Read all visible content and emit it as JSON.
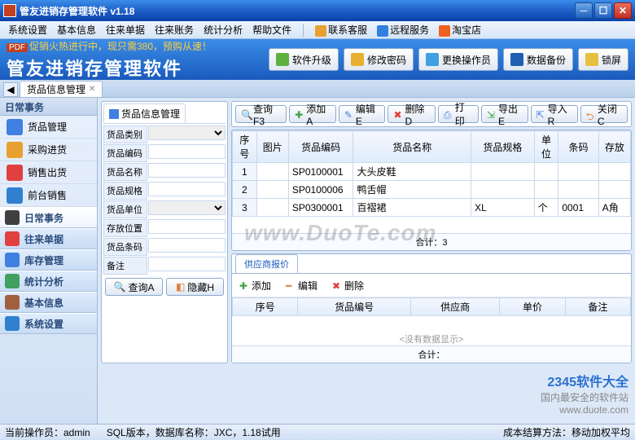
{
  "window": {
    "title": "管友进销存管理软件  v1.18"
  },
  "menu": {
    "items": [
      "系统设置",
      "基本信息",
      "往来单据",
      "往来账务",
      "统计分析",
      "帮助文件"
    ],
    "right": [
      {
        "label": "联系客服",
        "icon": "#e8a030"
      },
      {
        "label": "远程服务",
        "icon": "#3080e0"
      },
      {
        "label": "淘宝店",
        "icon": "#f06020"
      }
    ]
  },
  "banner": {
    "promo_badge": "PDF",
    "promo": "促销火热进行中，现只需380，预购从速！",
    "title": "管友进销存管理软件",
    "buttons": [
      {
        "label": "软件升级",
        "color": "#60b040"
      },
      {
        "label": "修改密码",
        "color": "#e8b030"
      },
      {
        "label": "更换操作员",
        "color": "#40a0e0"
      },
      {
        "label": "数据备份",
        "color": "#2060b0"
      },
      {
        "label": "锁屏",
        "color": "#e8c040"
      }
    ]
  },
  "tabs": {
    "active": "货品信息管理"
  },
  "sidebar": {
    "header": "日常事务",
    "items": [
      {
        "label": "货品管理",
        "color": "#4080e0"
      },
      {
        "label": "采购进货",
        "color": "#e8a030"
      },
      {
        "label": "销售出货",
        "color": "#e04040"
      },
      {
        "label": "前台销售",
        "color": "#3080d0"
      }
    ],
    "sections": [
      {
        "label": "日常事务",
        "color": "#404040",
        "active": true
      },
      {
        "label": "往来单据",
        "color": "#e04040"
      },
      {
        "label": "库存管理",
        "color": "#4080e0"
      },
      {
        "label": "统计分析",
        "color": "#40a060"
      },
      {
        "label": "基本信息",
        "color": "#a06040"
      },
      {
        "label": "系统设置",
        "color": "#3080d0"
      }
    ]
  },
  "filter": {
    "tab": "货品信息管理",
    "fields": [
      "货品类别",
      "货品编码",
      "货品名称",
      "货品规格",
      "货品单位",
      "存放位置",
      "货品条码",
      "备注"
    ],
    "btn_query": "查询A",
    "btn_hide": "隐藏H"
  },
  "toolbar": {
    "buttons": [
      {
        "label": "查询F3",
        "icon": "search",
        "color": "#4080e0"
      },
      {
        "label": "添加A",
        "icon": "plus",
        "color": "#40a040"
      },
      {
        "label": "编辑E",
        "icon": "edit",
        "color": "#4080e0"
      },
      {
        "label": "删除D",
        "icon": "delete",
        "color": "#e04040"
      },
      {
        "label": "打印",
        "icon": "print",
        "color": "#4080e0"
      },
      {
        "label": "导出E",
        "icon": "export",
        "color": "#40a040"
      },
      {
        "label": "导入R",
        "icon": "import",
        "color": "#4080e0"
      },
      {
        "label": "关闭C",
        "icon": "close",
        "color": "#e08040"
      }
    ]
  },
  "grid": {
    "columns": [
      "序号",
      "图片",
      "货品编码",
      "货品名称",
      "货品规格",
      "单位",
      "条码",
      "存放"
    ],
    "rows": [
      {
        "num": "1",
        "img": "",
        "code": "SP0100001",
        "name": "大头皮鞋",
        "spec": "",
        "unit": "",
        "barcode": "",
        "loc": ""
      },
      {
        "num": "2",
        "img": "",
        "code": "SP0100006",
        "name": "鸭舌帽",
        "spec": "",
        "unit": "",
        "barcode": "",
        "loc": ""
      },
      {
        "num": "3",
        "img": "",
        "code": "SP0300001",
        "name": "百褶裙",
        "spec": "XL",
        "unit": "个",
        "barcode": "0001",
        "loc": "A角"
      }
    ],
    "footer": "合计：3"
  },
  "subpanel": {
    "tab": "供应商报价",
    "btns": [
      {
        "label": "添加",
        "icon": "plus",
        "color": "#40a040"
      },
      {
        "label": "编辑",
        "icon": "minus",
        "color": "#e08040"
      },
      {
        "label": "删除",
        "icon": "delete",
        "color": "#e04040"
      }
    ],
    "columns": [
      "序号",
      "货品编号",
      "供应商",
      "单价",
      "备注"
    ],
    "nodata": "<没有数据显示>",
    "footer": "合计："
  },
  "status": {
    "left": "当前操作员：admin",
    "mid": "SQL版本，数据库名称：JXC，1.18试用",
    "right": "成本结算方法：移动加权平均"
  },
  "watermark": "www.DuoTe.com",
  "corner": {
    "brand": "2345软件大全",
    "sub": "国内最安全的软件站",
    "url": "www.duote.com"
  }
}
